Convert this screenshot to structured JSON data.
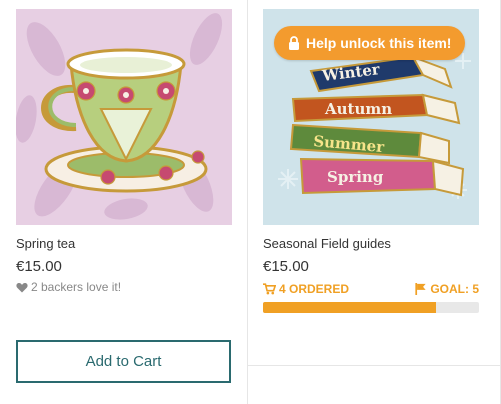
{
  "products": [
    {
      "title": "Spring tea",
      "price": "€15.00",
      "backers_text": "2 backers love it!",
      "add_to_cart_label": "Add to Cart",
      "image_icon": "teacup-pin-image"
    },
    {
      "title": "Seasonal Field guides",
      "price": "€15.00",
      "unlock_badge": "Help unlock this item!",
      "ordered_text": "4 ORDERED",
      "goal_text": "GOAL: 5",
      "progress_fraction": 0.8,
      "book_spines": [
        "Winter",
        "Autumn",
        "Summer",
        "Spring"
      ],
      "image_icon": "stacked-books-pin-image"
    }
  ],
  "colors": {
    "accent_orange": "#f39b2e",
    "button_teal": "#2a6a6f",
    "muted_text": "#888888"
  }
}
